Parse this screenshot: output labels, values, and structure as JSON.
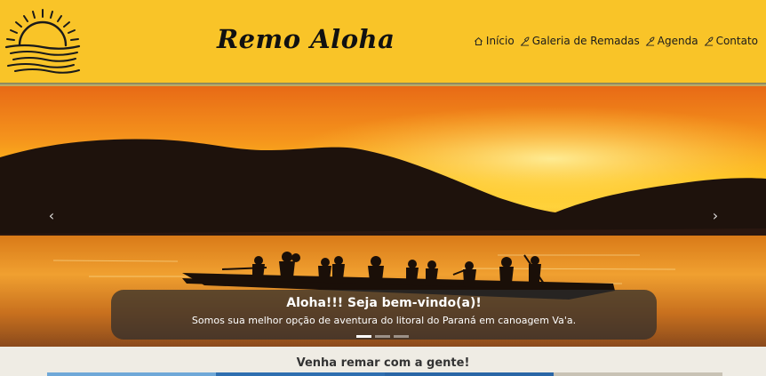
{
  "header": {
    "brand": "Remo Aloha",
    "logo": "sunset-over-waves-logo",
    "background": "#f9c428"
  },
  "nav": {
    "items": [
      {
        "label": "Início",
        "icon": "home-icon"
      },
      {
        "label": "Galeria de Remadas",
        "icon": "paddle-icon"
      },
      {
        "label": "Agenda",
        "icon": "paddle-icon"
      },
      {
        "label": "Contato",
        "icon": "paddle-icon"
      }
    ]
  },
  "carousel": {
    "prev_label": "‹",
    "next_label": "›",
    "caption_title": "Aloha!!! Seja bem-vindo(a)!",
    "caption_text": "Somos sua melhor opção de aventura do litoral do Paraná em canoagem Va'a.",
    "slides": 3,
    "active_slide": 1,
    "image": "outrigger-canoe-sunset-silhouette"
  },
  "section": {
    "title": "Venha remar com a gente!"
  },
  "cards": {
    "colors": [
      "#6fa8d8",
      "#2f6fb0",
      "#2a66a6",
      "#c8c2b4"
    ]
  }
}
